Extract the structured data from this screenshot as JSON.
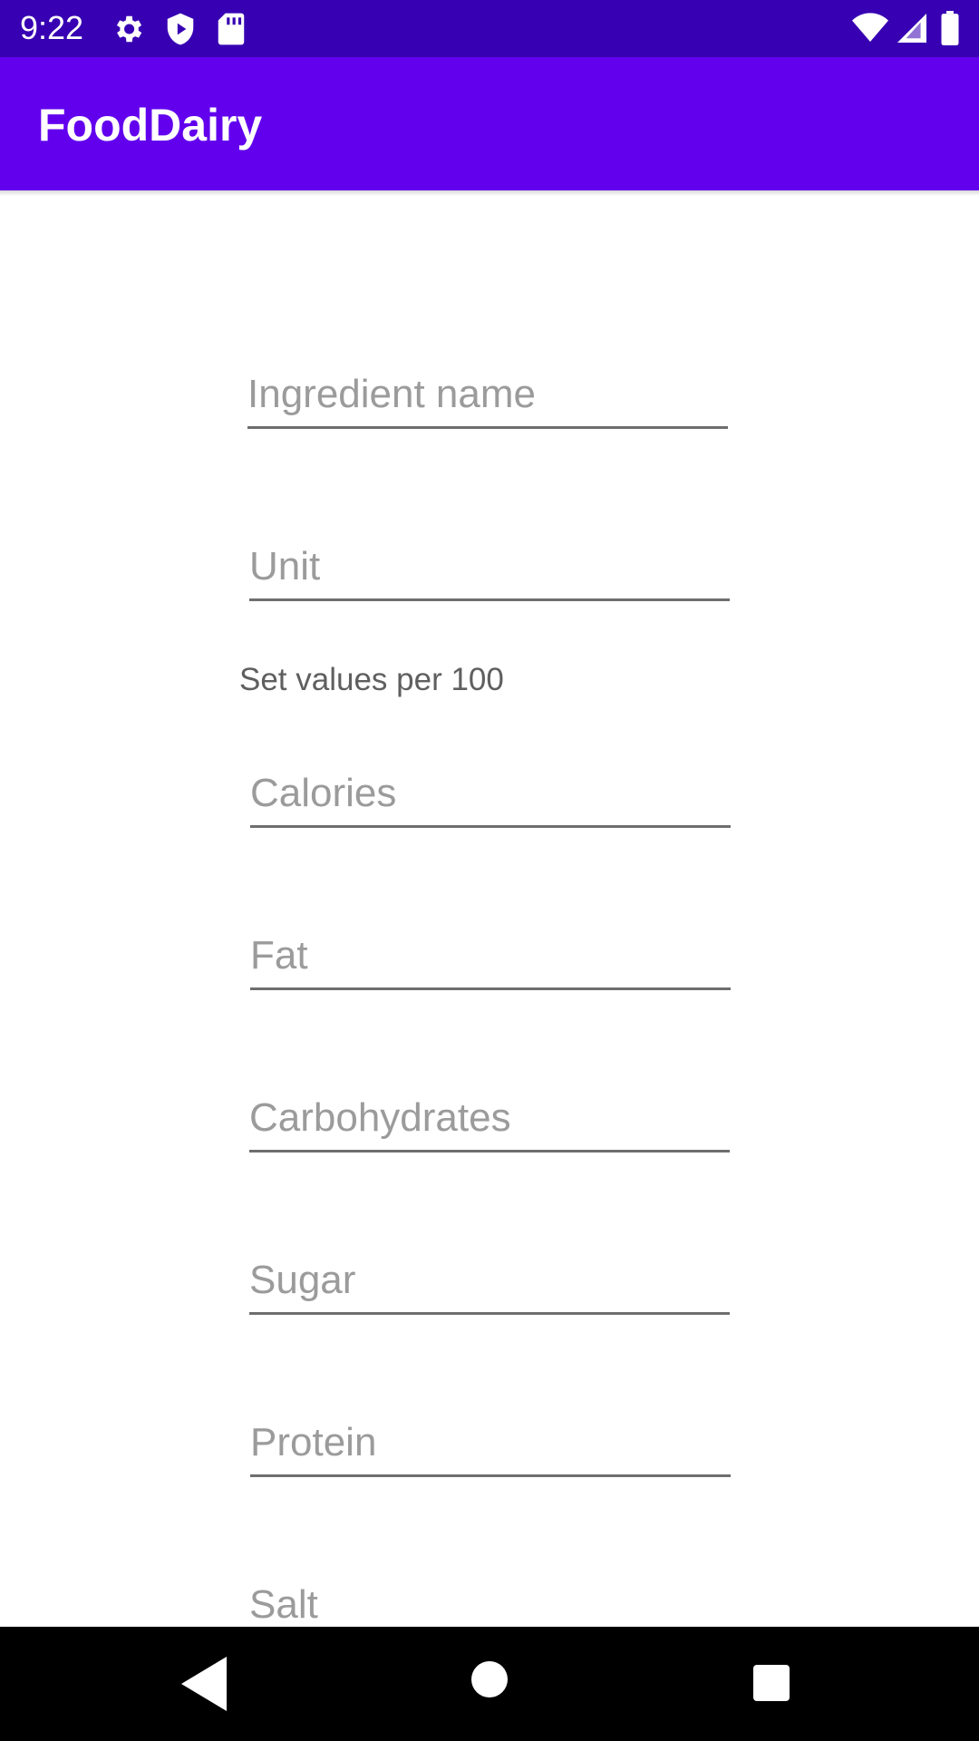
{
  "status_bar": {
    "time": "9:22",
    "icons_left": [
      "gear-icon",
      "shield-play-icon",
      "sd-card-icon"
    ],
    "icons_right": [
      "wifi-icon",
      "signal-icon",
      "battery-icon"
    ],
    "background": "#3700B3"
  },
  "app_bar": {
    "title": "FoodDairy",
    "background": "#6200EE"
  },
  "form": {
    "ingredient_name": {
      "placeholder": "Ingredient name",
      "value": ""
    },
    "unit": {
      "placeholder": "Unit",
      "value": ""
    },
    "section_label": "Set values per 100",
    "calories": {
      "placeholder": "Calories",
      "value": ""
    },
    "fat": {
      "placeholder": "Fat",
      "value": ""
    },
    "carbohydrates": {
      "placeholder": "Carbohydrates",
      "value": ""
    },
    "sugar": {
      "placeholder": "Sugar",
      "value": ""
    },
    "protein": {
      "placeholder": "Protein",
      "value": ""
    },
    "salt": {
      "placeholder": "Salt",
      "value": ""
    }
  },
  "nav_bar": {
    "buttons": [
      "back-icon",
      "home-icon",
      "recents-icon"
    ]
  }
}
